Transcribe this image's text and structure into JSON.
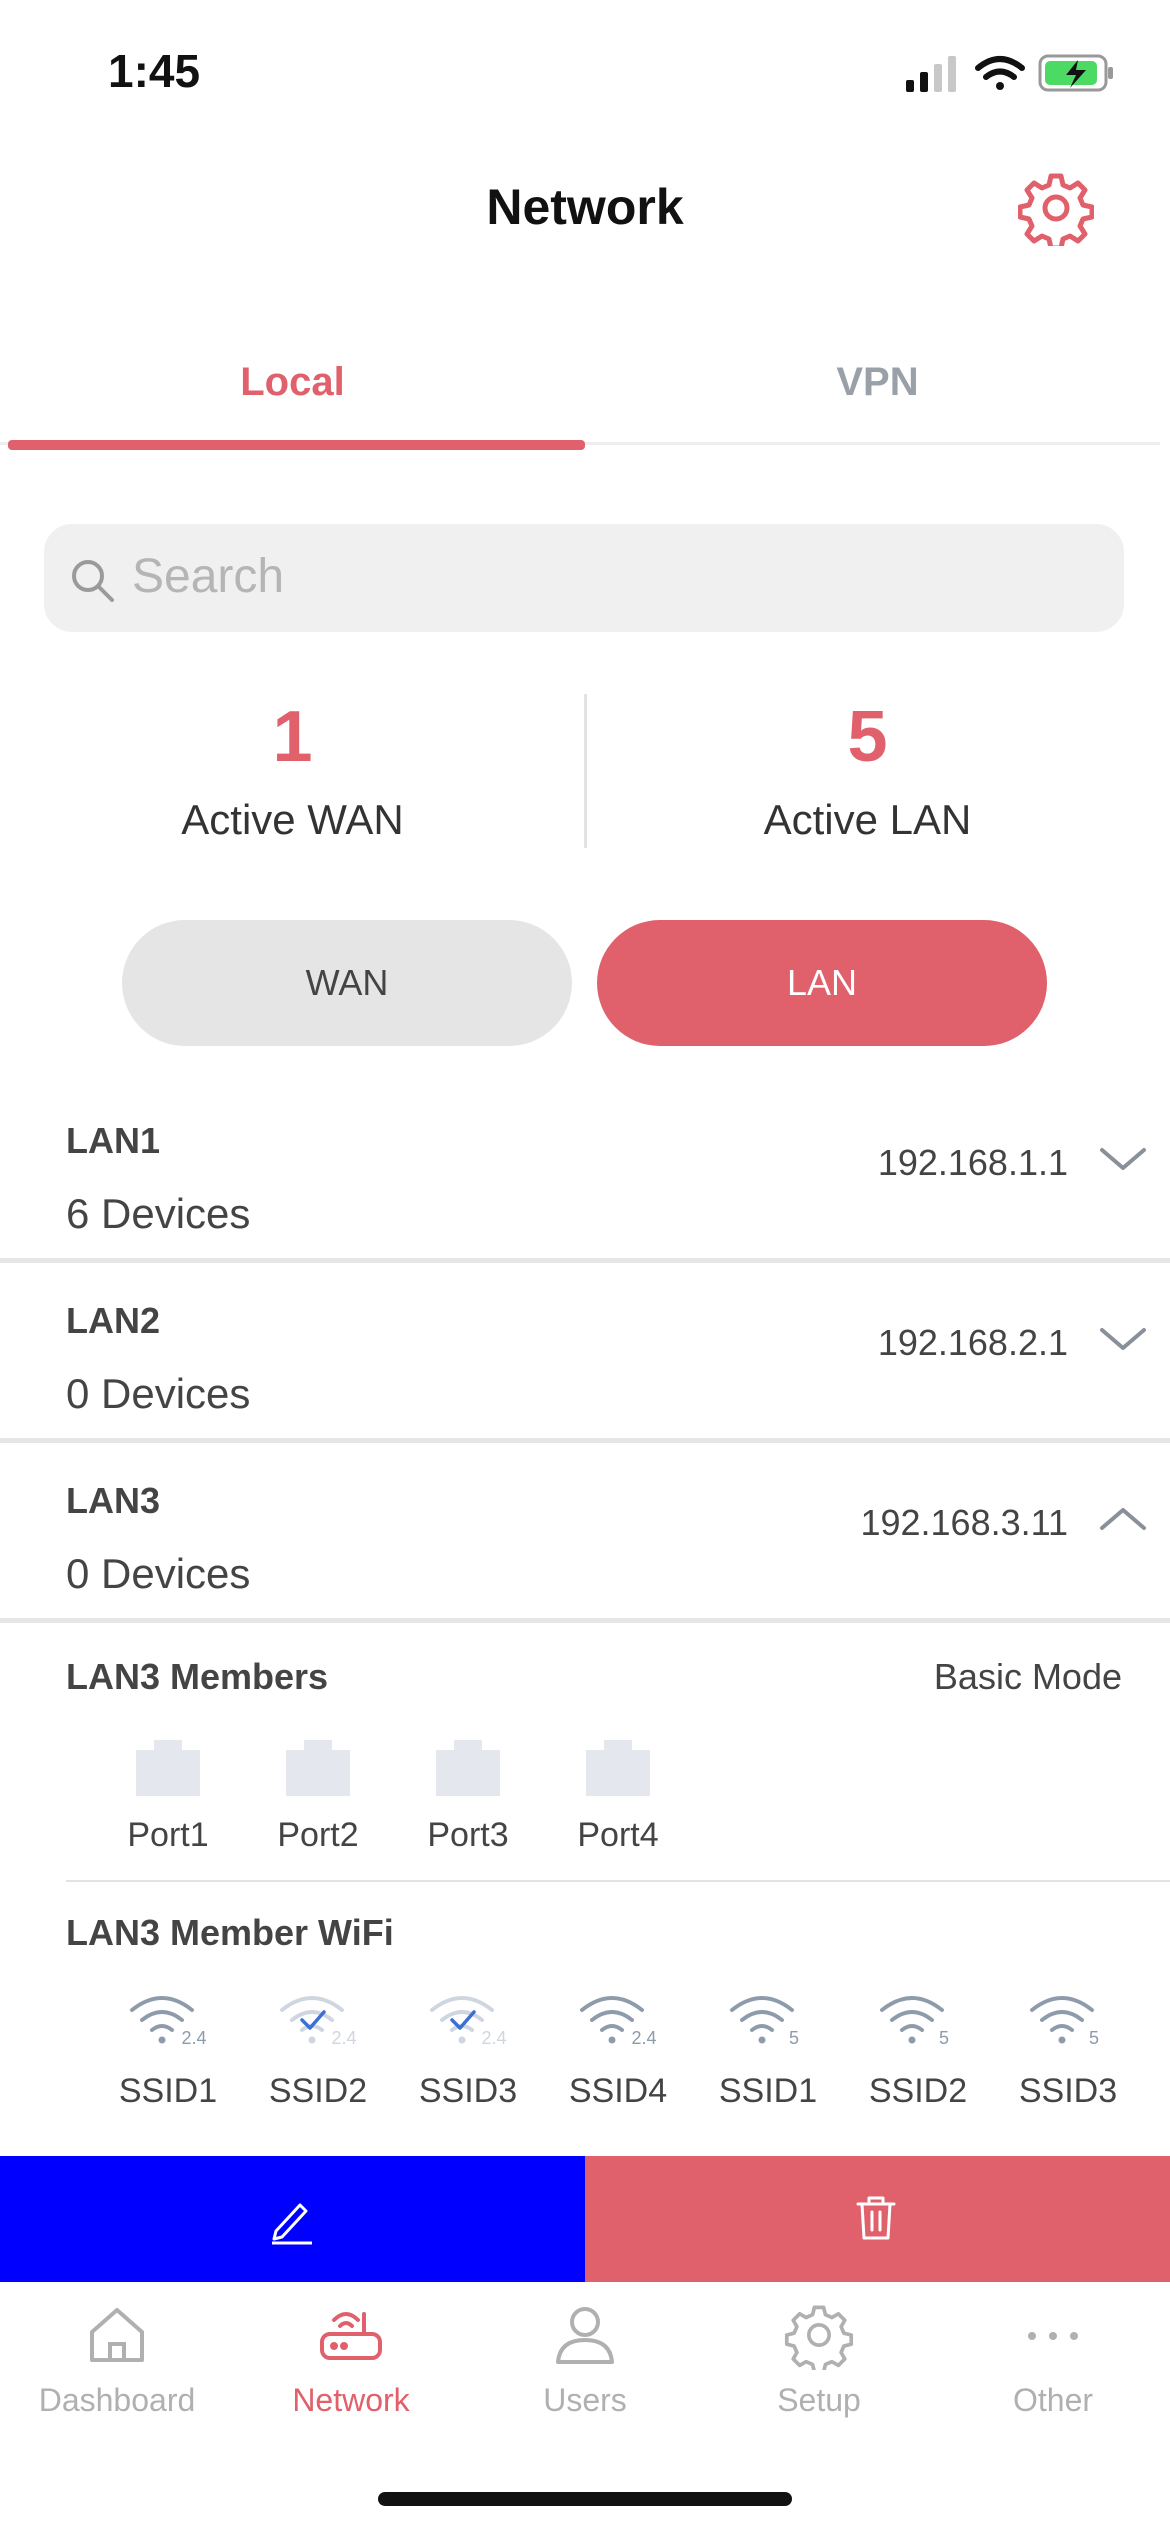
{
  "status_bar": {
    "time": "1:45"
  },
  "header": {
    "title": "Network"
  },
  "tabs": [
    {
      "label": "Local",
      "active": true
    },
    {
      "label": "VPN",
      "active": false
    }
  ],
  "search": {
    "placeholder": "Search"
  },
  "stats": [
    {
      "value": "1",
      "label": "Active WAN"
    },
    {
      "value": "5",
      "label": "Active LAN"
    }
  ],
  "segment": {
    "wan_label": "WAN",
    "lan_label": "LAN",
    "selected": "LAN"
  },
  "lans": [
    {
      "name": "LAN1",
      "devices": "6 Devices",
      "ip": "192.168.1.1",
      "expanded": false
    },
    {
      "name": "LAN2",
      "devices": "0 Devices",
      "ip": "192.168.2.1",
      "expanded": false
    },
    {
      "name": "LAN3",
      "devices": "0 Devices",
      "ip": "192.168.3.11",
      "expanded": true
    }
  ],
  "members": {
    "title": "LAN3 Members",
    "mode": "Basic Mode",
    "ports": [
      "Port1",
      "Port2",
      "Port3",
      "Port4"
    ]
  },
  "wifi": {
    "title": "LAN3 Member WiFi",
    "ssids": [
      {
        "label": "SSID1",
        "band": "2.4",
        "checked": false
      },
      {
        "label": "SSID2",
        "band": "2.4",
        "checked": true
      },
      {
        "label": "SSID3",
        "band": "2.4",
        "checked": true
      },
      {
        "label": "SSID4",
        "band": "2.4",
        "checked": false
      },
      {
        "label": "SSID1",
        "band": "5",
        "checked": false
      },
      {
        "label": "SSID2",
        "band": "5",
        "checked": false
      },
      {
        "label": "SSID3",
        "band": "5",
        "checked": false
      }
    ]
  },
  "colors": {
    "accent": "#e0606b",
    "edit": "#0000ff",
    "muted": "#9aa0a8"
  },
  "nav": [
    {
      "label": "Dashboard",
      "icon": "home-icon",
      "active": false
    },
    {
      "label": "Network",
      "icon": "router-icon",
      "active": true
    },
    {
      "label": "Users",
      "icon": "user-icon",
      "active": false
    },
    {
      "label": "Setup",
      "icon": "gear-icon",
      "active": false
    },
    {
      "label": "Other",
      "icon": "more-icon",
      "active": false
    }
  ]
}
